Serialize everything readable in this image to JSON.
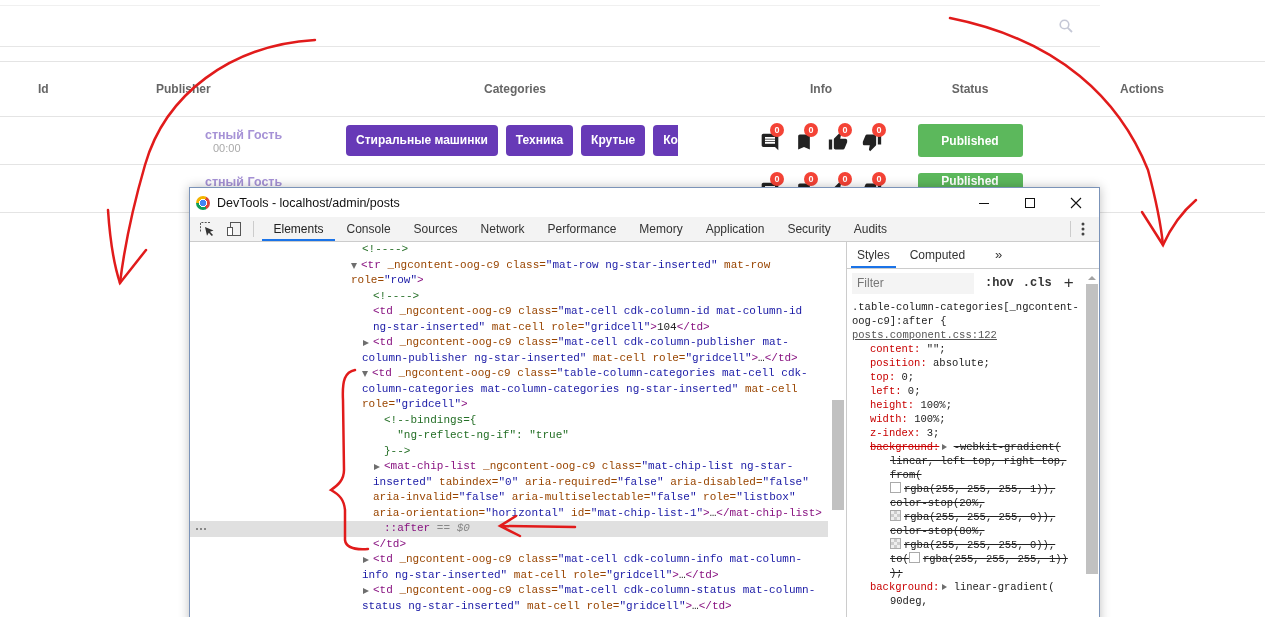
{
  "page": {
    "table": {
      "columns": [
        "Id",
        "Publisher",
        "Categories",
        "Info",
        "Status",
        "Actions"
      ],
      "rows": [
        {
          "publisher": "стный Гость",
          "date": "00:00",
          "categories": [
            "Стиральные машинки",
            "Техника",
            "Крутые",
            "Ко"
          ],
          "info": [
            {
              "kind": "comment",
              "count": "0"
            },
            {
              "kind": "bookmark",
              "count": "0"
            },
            {
              "kind": "like",
              "count": "0"
            },
            {
              "kind": "dislike",
              "count": "0"
            }
          ],
          "status": "Published"
        },
        {
          "publisher": "стный Гость",
          "info": [
            {
              "kind": "comment",
              "count": "0"
            },
            {
              "kind": "bookmark",
              "count": "0"
            },
            {
              "kind": "like",
              "count": "0"
            },
            {
              "kind": "dislike",
              "count": "0"
            }
          ],
          "status": "Published"
        }
      ]
    }
  },
  "devtools": {
    "title": "DevTools - localhost/admin/posts",
    "tabs": [
      {
        "label": "Elements",
        "selected": true
      },
      {
        "label": "Console",
        "selected": false
      },
      {
        "label": "Sources",
        "selected": false
      },
      {
        "label": "Network",
        "selected": false
      },
      {
        "label": "Performance",
        "selected": false
      },
      {
        "label": "Memory",
        "selected": false
      },
      {
        "label": "Application",
        "selected": false
      },
      {
        "label": "Security",
        "selected": false
      },
      {
        "label": "Audits",
        "selected": false
      }
    ],
    "elements": {
      "nodes": [
        {
          "kind": "comment",
          "text": "<!---->",
          "selected": false
        },
        {
          "kind": "element",
          "expanded": true,
          "selected": false,
          "open": "<tr",
          "attrs": [
            {
              "name": "_ngcontent-oog-c9"
            },
            {
              "name": "class=",
              "value": "\"mat-row ng-star-inserted\""
            },
            {
              "name": "mat-row"
            },
            {
              "name": "role=",
              "value": "\"row\""
            }
          ],
          "end": ">",
          "children": [
            {
              "kind": "comment",
              "text": "<!---->",
              "selected": false
            },
            {
              "kind": "element",
              "selected": false,
              "open": "<td",
              "attrs": [
                {
                  "name": "_ngcontent-oog-c9"
                },
                {
                  "name": "class=",
                  "value": "\"mat-cell cdk-column-id mat-column-id ng-star-inserted\""
                },
                {
                  "name": "mat-cell"
                },
                {
                  "name": "role=",
                  "value": "\"gridcell\""
                }
              ],
              "end": ">",
              "content": "104",
              "close": "</td>"
            },
            {
              "kind": "element",
              "expanded": false,
              "selected": false,
              "open": "<td",
              "attrs": [
                {
                  "name": "_ngcontent-oog-c9"
                },
                {
                  "name": "class=",
                  "value": "\"mat-cell cdk-column-publisher mat-column-publisher ng-star-inserted\""
                },
                {
                  "name": "mat-cell"
                },
                {
                  "name": "role=",
                  "value": "\"gridcell\""
                }
              ],
              "end": ">",
              "content": "…",
              "close": "</td>"
            },
            {
              "kind": "element",
              "expanded": true,
              "selected": false,
              "open": "<td",
              "attrs": [
                {
                  "name": "_ngcontent-oog-c9"
                },
                {
                  "name": "class=",
                  "value": "\"table-column-categories mat-cell cdk-column-categories mat-column-categories ng-star-inserted\""
                },
                {
                  "name": "mat-cell"
                },
                {
                  "name": "role=",
                  "value": "\"gridcell\""
                }
              ],
              "end": ">",
              "children": [
                {
                  "kind": "comment",
                  "text": "<!--bindings={\n  \"ng-reflect-ng-if\": \"true\"\n}-->",
                  "selected": false
                },
                {
                  "kind": "element",
                  "expanded": false,
                  "selected": false,
                  "open": "<mat-chip-list",
                  "attrs": [
                    {
                      "name": "_ngcontent-oog-c9"
                    },
                    {
                      "name": "class=",
                      "value": "\"mat-chip-list ng-star-inserted\""
                    },
                    {
                      "name": "tabindex=",
                      "value": "\"0\""
                    },
                    {
                      "name": "aria-required=",
                      "value": "\"false\""
                    },
                    {
                      "name": "aria-disabled=",
                      "value": "\"false\""
                    },
                    {
                      "name": "aria-invalid=",
                      "value": "\"false\""
                    },
                    {
                      "name": "aria-multiselectable=",
                      "value": "\"false\""
                    },
                    {
                      "name": "role=",
                      "value": "\"listbox\""
                    },
                    {
                      "name": "aria-orientation=",
                      "value": "\"horizontal\""
                    },
                    {
                      "name": "id=",
                      "value": "\"mat-chip-list-1\""
                    }
                  ],
                  "end": ">",
                  "content": "…",
                  "close": "</mat-chip-list>"
                },
                {
                  "kind": "pseudo",
                  "text": "::after",
                  "console_ref": "== $0",
                  "selected": true
                }
              ],
              "close": "</td>"
            },
            {
              "kind": "element",
              "expanded": false,
              "selected": false,
              "open": "<td",
              "attrs": [
                {
                  "name": "_ngcontent-oog-c9"
                },
                {
                  "name": "class=",
                  "value": "\"mat-cell cdk-column-info mat-column-info ng-star-inserted\""
                },
                {
                  "name": "mat-cell"
                },
                {
                  "name": "role=",
                  "value": "\"gridcell\""
                }
              ],
              "end": ">",
              "content": "…",
              "close": "</td>"
            },
            {
              "kind": "element",
              "expanded": false,
              "selected": false,
              "open": "<td",
              "attrs": [
                {
                  "name": "_ngcontent-oog-c9"
                },
                {
                  "name": "class=",
                  "value": "\"mat-cell cdk-column-status mat-column-status ng-star-inserted\""
                },
                {
                  "name": "mat-cell"
                },
                {
                  "name": "role=",
                  "value": "\"gridcell\""
                }
              ],
              "end": ">",
              "content": "…",
              "close": "</td>"
            }
          ]
        }
      ]
    },
    "styles": {
      "tabs": [
        {
          "label": "Styles",
          "selected": true
        },
        {
          "label": "Computed",
          "selected": false
        }
      ],
      "more": "»",
      "filter": {
        "placeholder": "Filter"
      },
      "buttons": [
        ":hov",
        ".cls",
        "+"
      ],
      "rule": {
        "selector": ".table-column-categories[_ngcontent-oog-c9]:after {",
        "source": "posts.component.css:122",
        "declarations": [
          {
            "name": "content:",
            "struck": false,
            "value_lines": [
              [
                {
                  "text": "\"\";"
                }
              ]
            ]
          },
          {
            "name": "position:",
            "struck": false,
            "value_lines": [
              [
                {
                  "text": "absolute;"
                }
              ]
            ]
          },
          {
            "name": "top:",
            "struck": false,
            "value_lines": [
              [
                {
                  "text": "0;"
                }
              ]
            ]
          },
          {
            "name": "left:",
            "struck": false,
            "value_lines": [
              [
                {
                  "text": "0;"
                }
              ]
            ]
          },
          {
            "name": "height:",
            "struck": false,
            "value_lines": [
              [
                {
                  "text": "100%;"
                }
              ]
            ]
          },
          {
            "name": "width:",
            "struck": false,
            "value_lines": [
              [
                {
                  "text": "100%;"
                }
              ]
            ]
          },
          {
            "name": "z-index:",
            "struck": false,
            "value_lines": [
              [
                {
                  "text": "3;"
                }
              ]
            ]
          },
          {
            "name": "background:",
            "struck": true,
            "expandable": true,
            "value_lines": [
              [
                {
                  "text": "-webkit-gradient("
                }
              ],
              [
                {
                  "text": "linear, left top, right top,"
                }
              ],
              [
                {
                  "text": "from("
                }
              ],
              [
                {
                  "kind": "opaque-swatch"
                },
                {
                  "kind": "text",
                  "text": "rgba(255, 255, 255, 1)),"
                }
              ],
              [
                {
                  "text": "color-stop(20%,"
                }
              ],
              [
                {
                  "kind": "transparent-swatch"
                },
                {
                  "kind": "text",
                  "text": "rgba(255, 255, 255, 0)),"
                }
              ],
              [
                {
                  "text": "color-stop(80%,"
                }
              ],
              [
                {
                  "kind": "transparent-swatch"
                },
                {
                  "kind": "text",
                  "text": "rgba(255, 255, 255, 0)),"
                }
              ],
              [
                {
                  "kind": "text",
                  "text": "to("
                },
                {
                  "kind": "opaque-swatch"
                },
                {
                  "kind": "text",
                  "text": "rgba(255, 255, 255, 1))"
                }
              ],
              [
                {
                  "text": ");"
                }
              ]
            ]
          },
          {
            "name": "background:",
            "struck": false,
            "expandable": true,
            "value_lines": [
              [
                {
                  "text": "linear-gradient("
                }
              ],
              [
                {
                  "text": "90deg,"
                }
              ]
            ]
          }
        ]
      }
    }
  }
}
